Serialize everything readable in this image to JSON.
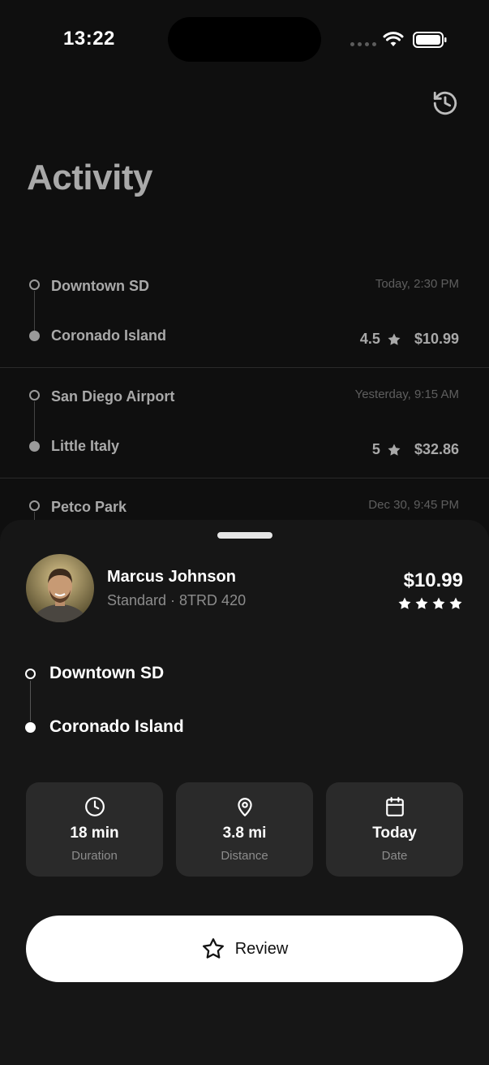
{
  "status_bar": {
    "time": "13:22"
  },
  "header": {
    "title": "Activity",
    "history_icon": "history-icon"
  },
  "trips": [
    {
      "from": "Downtown SD",
      "to": "Coronado Island",
      "when": "Today, 2:30 PM",
      "rating": "4.5",
      "price": "$10.99"
    },
    {
      "from": "San Diego Airport",
      "to": "Little Italy",
      "when": "Yesterday, 9:15 AM",
      "rating": "5",
      "price": "$32.86"
    },
    {
      "from": "Petco Park",
      "to": "",
      "when": "Dec 30, 9:45 PM",
      "rating": "",
      "price": ""
    }
  ],
  "detail": {
    "driver_name": "Marcus Johnson",
    "driver_sub": "Standard · 8TRD 420",
    "fare": "$10.99",
    "star_count": 4,
    "origin": "Downtown SD",
    "destination": "Coronado Island",
    "stats": [
      {
        "icon": "clock-icon",
        "value": "18 min",
        "label": "Duration"
      },
      {
        "icon": "map-pin-icon",
        "value": "3.8 mi",
        "label": "Distance"
      },
      {
        "icon": "calendar-icon",
        "value": "Today",
        "label": "Date"
      }
    ],
    "review_label": "Review"
  },
  "colors": {
    "background": "#0f0f0f",
    "sheet": "#161616",
    "card": "#2a2a2a",
    "muted": "#a9a9a9",
    "button": "#ffffff"
  }
}
